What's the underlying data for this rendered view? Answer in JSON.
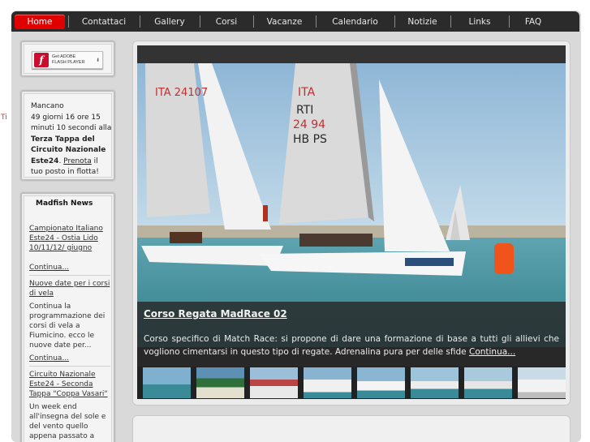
{
  "nav": {
    "items": [
      {
        "label": "Home",
        "active": true
      },
      {
        "label": "Contattaci"
      },
      {
        "label": "Gallery"
      },
      {
        "label": "Corsi"
      },
      {
        "label": "Vacanze"
      },
      {
        "label": "Calendario"
      },
      {
        "label": "Notizie"
      },
      {
        "label": "Links"
      },
      {
        "label": "FAQ"
      }
    ]
  },
  "side_mark": "Ti",
  "flash": {
    "line1": "Get ADOBE",
    "line2": "FLASH PLAYER",
    "logo_letter": "f",
    "icon": "flash-player-logo"
  },
  "countdown": {
    "t1": "Mancano",
    "t2": "49 giorni 16 ore 15 minuti 10 secondi alla ",
    "strong": "Terza Tappa del Circuito Nazionale Este24",
    "t3": ". ",
    "link": "Prenota",
    "t4": " il tuo posto in flotta!"
  },
  "news": {
    "title": "Madfish News",
    "items": [
      {
        "link": "Campionato Italiano Este24 - Ostia Lido 10/11/12/ giugno",
        "more": "Continua..."
      },
      {
        "link": "Nuove date per i corsi di vela",
        "body": "Continua la programmazione dei corsi di vela a Fiumicino. ecco le nuove date per...",
        "more": "Continua..."
      },
      {
        "link": "Circuito Nazionale Este24 - Seconda Tappa \"Coppa Vasari\"",
        "body": "Un week end all'insegna del sole e del vento quello appena passato a Santa Marinella..."
      }
    ]
  },
  "slide": {
    "title": "Corso Regata MadRace 02",
    "text": "Corso specifico di Match Race: si propone di dare una formazione di base a tutti gli allievi che vogliono cimentarsi in questo tipo di regate. Adrenalina pura per delle sfide ",
    "more": "Continua...",
    "sail_numbers": [
      "ITA 24107",
      "ITA",
      "RTI",
      "24 94",
      "HB PS"
    ]
  },
  "colors": {
    "nav_bg": "#2b2b2b",
    "active": "#e00000",
    "panel": "#ececec"
  }
}
